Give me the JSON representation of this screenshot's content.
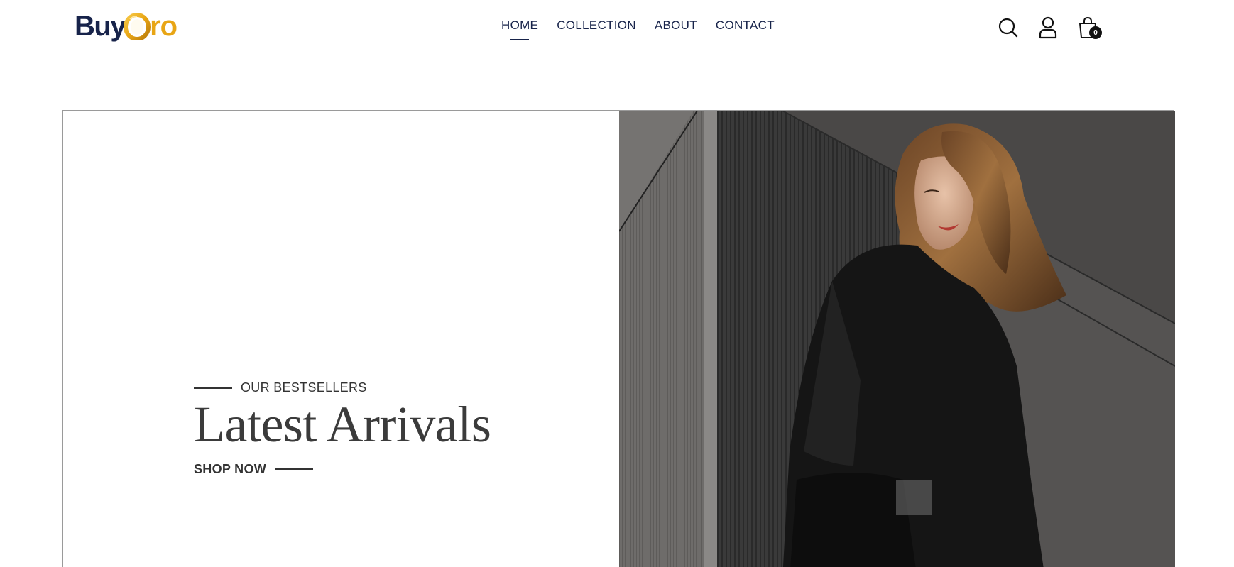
{
  "brand": {
    "logo_part1": "Buy",
    "logo_part2": "ro",
    "logo_letter_o": "O",
    "brand_navy": "#17234a",
    "brand_gold": "#e8a514"
  },
  "nav": {
    "items": [
      {
        "label": "HOME",
        "active": true
      },
      {
        "label": "COLLECTION",
        "active": false
      },
      {
        "label": "ABOUT",
        "active": false
      },
      {
        "label": "CONTACT",
        "active": false
      }
    ]
  },
  "header_icons": {
    "search": "search-icon",
    "account": "user-icon",
    "cart": "shopping-bag-icon",
    "cart_count": "0"
  },
  "hero": {
    "eyebrow": "OUR BESTSELLERS",
    "title": "Latest Arrivals",
    "cta": "SHOP NOW",
    "image": "woman in black jacket against concrete wall"
  }
}
